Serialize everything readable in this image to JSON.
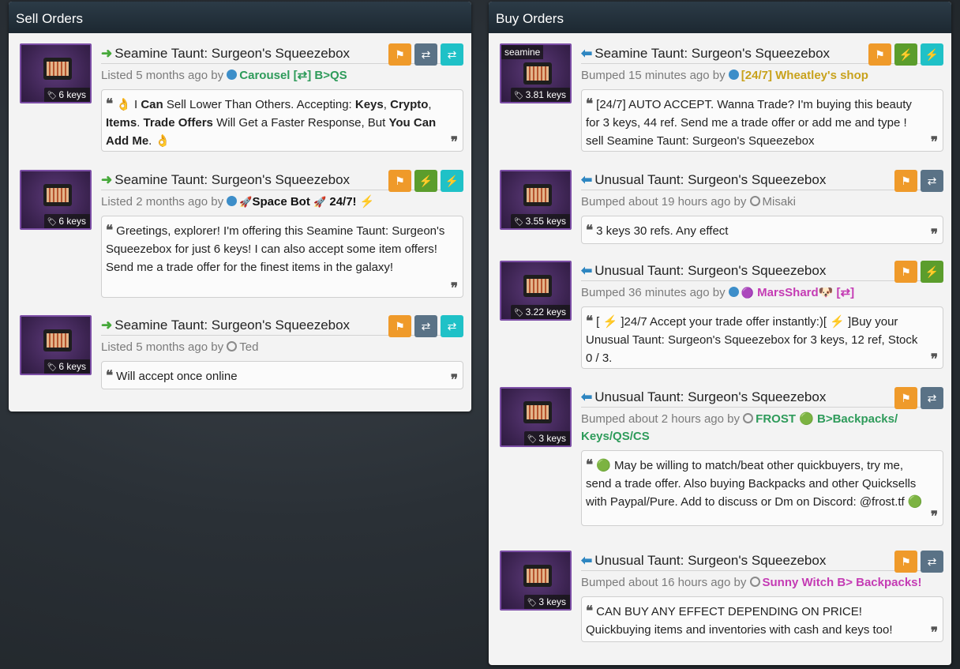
{
  "sell": {
    "title": "Sell Orders",
    "orders": [
      {
        "item": "Seamine Taunt: Surgeon's Squeezebox",
        "price": "6 keys",
        "listed": "Listed 5 months ago by",
        "user": "Carousel [⇄] B>QS",
        "user_color": "#2e9b5a",
        "online": true,
        "buttons": [
          "flag",
          "trade",
          "instant"
        ],
        "comment_pre": "👌 I ",
        "comment_b1": "Can",
        "comment_m1": " Sell Lower Than Others. Accepting: ",
        "comment_b2": "Keys",
        "comment_m2": ", ",
        "comment_b3": "Crypto",
        "comment_m3": ", ",
        "comment_b4": "Items",
        "comment_m4": ". ",
        "comment_b5": "Trade Offers",
        "comment_m5": " Will Get a Faster Response, But ",
        "comment_b6": "You Can Add Me",
        "comment_m6": ". 👌"
      },
      {
        "item": "Seamine Taunt: Surgeon's Squeezebox",
        "price": "6 keys",
        "listed": "Listed 2 months ago by",
        "user": "Space Bot",
        "user_suffix": "24/7!",
        "user_color": "#111111",
        "online": true,
        "buttons": [
          "flag",
          "bolt",
          "instant"
        ],
        "comment": "Greetings, explorer! I'm offering this Seamine Taunt: Surgeon's Squeezebox for just 6 keys! I can also accept some item offers! Send me a trade offer for the finest items in the galaxy!"
      },
      {
        "item": "Seamine Taunt: Surgeon's Squeezebox",
        "price": "6 keys",
        "listed": "Listed 5 months ago by",
        "user": "Ted",
        "user_color": "#7b7b7b",
        "online": false,
        "buttons": [
          "flag",
          "trade",
          "instant"
        ],
        "comment": "Will accept once online"
      }
    ]
  },
  "buy": {
    "title": "Buy Orders",
    "orders": [
      {
        "item": "Seamine Taunt: Surgeon's Squeezebox",
        "price": "3.81 keys",
        "effect": "seamine",
        "listed": "Bumped 15 minutes ago by",
        "user": "[24/7] Wheatley's shop",
        "user_color": "#c8a21c",
        "online": true,
        "buttons": [
          "flag",
          "bolt",
          "instant"
        ],
        "comment": "[24/7] AUTO ACCEPT. Wanna Trade? I'm buying this beauty for 3 keys, 44 ref. Send me a trade offer or add me and type ! sell Seamine Taunt: Surgeon's Squeezebox"
      },
      {
        "item": "Unusual Taunt: Surgeon's Squeezebox",
        "price": "3.55 keys",
        "listed": "Bumped about 19 hours ago by",
        "user": "Misaki",
        "user_color": "#7b7b7b",
        "online": false,
        "buttons": [
          "flag",
          "trade"
        ],
        "comment": "3 keys 30 refs. Any effect"
      },
      {
        "item": "Unusual Taunt: Surgeon's Squeezebox",
        "price": "3.22 keys",
        "listed": "Bumped 36 minutes ago by",
        "user": "MarsShard🐶 [⇄]",
        "user_color": "#c43bb4",
        "online": true,
        "buttons": [
          "flag",
          "bolt"
        ],
        "comment": "[ ⚡ ]24/7 Accept your trade offer instantly:)[ ⚡ ]Buy your Unusual Taunt: Surgeon's Squeezebox for 3 keys, 12 ref, Stock 0 / 3."
      },
      {
        "item": "Unusual Taunt: Surgeon's Squeezebox",
        "price": "3 keys",
        "listed": "Bumped about 2 hours ago by",
        "user": "FROST 🟢  B>Backpacks/ Keys/QS/CS",
        "user_color": "#2e9b5a",
        "online": false,
        "buttons": [
          "flag",
          "trade"
        ],
        "comment": "🟢 May be willing to match/beat other quickbuyers, try me, send a trade offer. Also buying Backpacks and other Quicksells with Paypal/Pure. Add to discuss or Dm on Discord: @frost.tf 🟢"
      },
      {
        "item": "Unusual Taunt: Surgeon's Squeezebox",
        "price": "3 keys",
        "listed": "Bumped about 16 hours ago by",
        "user": "Sunny Witch B> Backpacks!",
        "user_color": "#c43bb4",
        "online": false,
        "buttons": [
          "flag",
          "trade"
        ],
        "comment": "CAN BUY ANY EFFECT DEPENDING ON PRICE! Quickbuying items and inventories with cash and keys too!"
      }
    ]
  },
  "icons": {
    "flag": "flag-icon",
    "trade": "exchange-icon",
    "instant": "instant-trade-icon",
    "bolt": "lightning-icon",
    "tag": "tag-icon",
    "quote": "quote-icon",
    "arrow_sell": "arrow-right-icon",
    "arrow_buy": "arrow-left-icon"
  },
  "colors": {
    "flag": "#ef9a2a",
    "trade": "#5a7286",
    "instant": "#1fc1c7",
    "bolt": "#5b9d2c",
    "sell_arrow": "#46a83a",
    "buy_arrow": "#2e86c1",
    "thumb_border": "#7c4ea6"
  }
}
